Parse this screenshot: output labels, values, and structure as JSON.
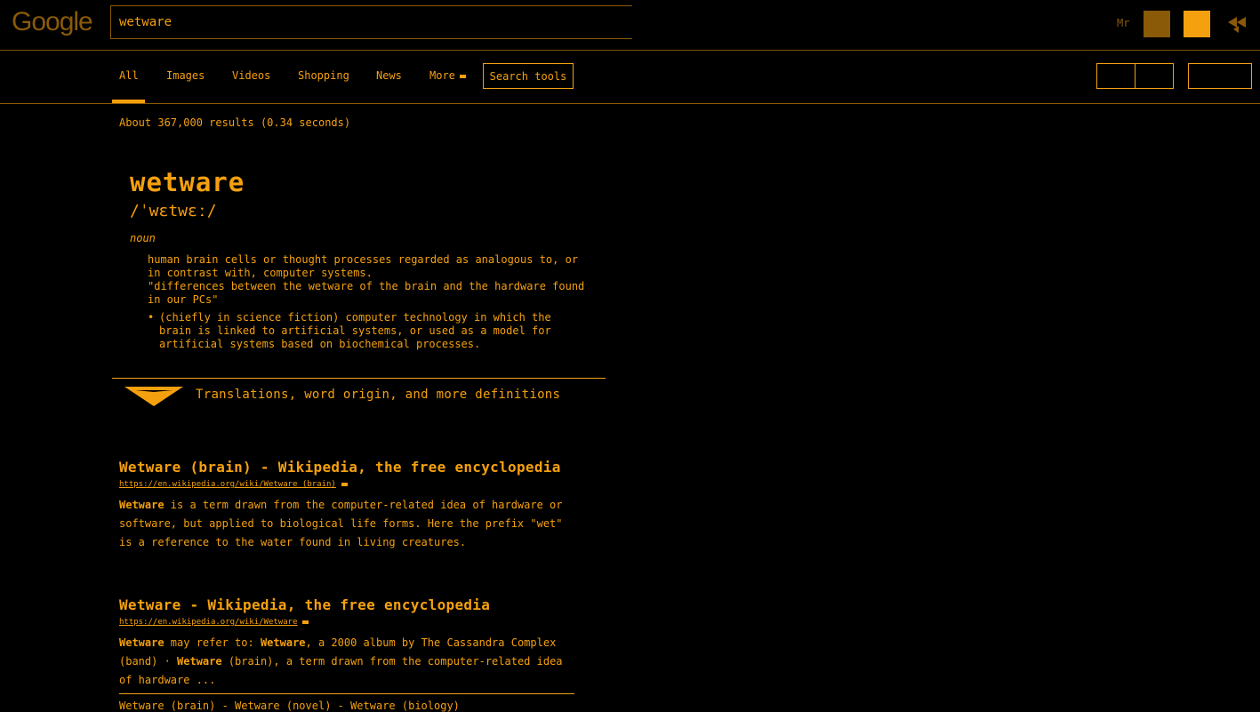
{
  "header": {
    "logo": "Google",
    "search_value": "wetware",
    "user_initials": "Mr",
    "share_icon": "share-icon"
  },
  "nav": {
    "tabs": [
      "All",
      "Images",
      "Videos",
      "Shopping",
      "News",
      "More"
    ],
    "active_tab": "All",
    "search_tools": "Search tools"
  },
  "stats": "About 367,000 results (0.34 seconds)",
  "dictionary": {
    "word": "wetware",
    "phonetic": "/ˈwɛtwɛː/",
    "part_of_speech": "noun",
    "definition_1": "human brain cells or thought processes regarded as analogous to, or in contrast with, computer systems.",
    "example_1": "\"differences between the wetware of the brain and the hardware found in our PCs\"",
    "sub_bullet": "•",
    "definition_2": "(chiefly in science fiction) computer technology in which the brain is linked to artificial systems, or used as a model for artificial systems based on biochemical processes.",
    "more_link": "Translations, word origin, and more definitions"
  },
  "results": [
    {
      "title": "Wetware (brain) - Wikipedia, the free encyclopedia",
      "url": "https://en.wikipedia.org/wiki/Wetware_(brain)",
      "snippet_bold": "Wetware",
      "snippet_rest": " is a term drawn from the computer-related idea of hardware or software, but applied to biological life forms. Here the prefix \"wet\" is a reference to the water found in living creatures."
    },
    {
      "title": "Wetware - Wikipedia, the free encyclopedia",
      "url": "https://en.wikipedia.org/wiki/Wetware",
      "snippet_parts": [
        "Wetware",
        " may refer to: ",
        "Wetware",
        ", a 2000 album by The Cassandra Complex (band) · ",
        "Wetware",
        " (brain), a term drawn from the computer-related idea of hardware ..."
      ],
      "sitelinks": "Wetware (brain) - Wetware (novel) - Wetware (biology)"
    }
  ],
  "colors": {
    "accent": "#f5a00f",
    "dim": "#8a5a08",
    "background": "#000000"
  }
}
